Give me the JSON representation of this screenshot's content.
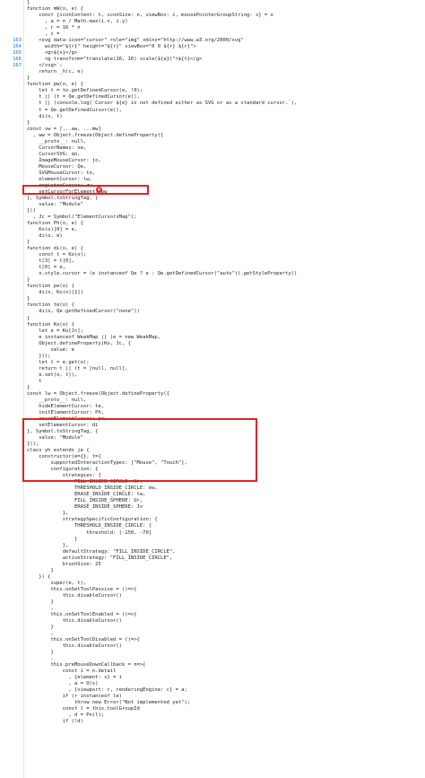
{
  "lines": [
    "}",
    "function mW(o, e) {",
    "    const {iconContent: t, iconSize: n, viewBox: i, mousePointerGroupString: s} = o",
    "      , a = n / Math.max(i.x, i.y)",
    "      , r = 16 * n",
    "      , c = `",
    "    <svg data-icon=\"cursor\" role=\"img\" xmlns=\"http://www.w3.org/2000/svg\"",
    "      width=\"${r}\" height=\"${r}\" viewBox=\"0 0 ${r} ${r}\">",
    "      <g>${s}</g>",
    "      <g transform=\"translate(16, 16) scale(${a})\">${t}</g>",
    "    </svg>`;",
    "    return _h(c, e)",
    "}",
    "function pw(o, e) {",
    "    let t = to.getDefinedCursor(e, !0);",
    "    t || (t = Qe.getDefinedCursor(e)),",
    "    t || (console.log(`Cursor ${e} is not defined either as SVG or as a standard cursor.`),",
    "    t = Qe.getDefinedCursor(e)),",
    "    di(o, t)",
    "}",
    "const vw = [...aw, ...mw]",
    "  , ww = Object.freeze(Object.defineProperty({",
    "    __proto__: null,",
    "    CursorNames: vw,",
    "    CursorSVG: qo,",
    "    ImageMouseCursor: jo,",
    "    MouseCursor: Qe,",
    "    SVGMouseCursor: to,",
    "    elementCursor: lw,",
    "    registerCursor: zw,",
    "    setCursorForElement: pw",
    "}, Symbol.toStringTag, {",
    "    value: \"Module\"",
    "}))",
    "  , Jc = Symbol(\"ElementCursorsMap\");",
    "function Ph(o, e) {",
    "    Ko(o)[0] = e,",
    "    di(o, e)",
    "}",
    "function di(o, e) {",
    "    const t = Ko(o);",
    "    t[3] = t[0],",
    "    t[0] = e,",
    "    o.style.cursor = (e instanceof Qe ? e : Qe.getDefinedCursor(\"auto\")).getStyleProperty()",
    "}",
    "function pe(o) {",
    "    di(o, Ko(o)[1])",
    "}",
    "function te(o) {",
    "    di(o, Qe.getDefinedCursor(\"none\"))",
    "}",
    "function Ko(o) {",
    "    let e = Ko[Jc];",
    "    e instanceof WeakMap || (e = new WeakMap,",
    "    Object.defineProperty(Ko, Jc, {",
    "        value: e",
    "    }));",
    "    let t = e.get(o);",
    "    return t || (t = [null, null],",
    "    e.set(o, t)),",
    "    t",
    "}",
    "const lw = Object.freeze(Object.defineProperty({",
    "    __proto__: null,",
    "    hideElementCursor: te,",
    "    initElementCursor: Ph,",
    "    resetElementCursor: pe,",
    "    setElementCursor: di",
    "}, Symbol.toStringTag, {",
    "    value: \"Module\"",
    "}));",
    "class yh extends je {",
    "    constructor(e={}, t={",
    "        supportedInteractionTypes: [\"Mouse\", \"Touch\"],",
    "        configuration: {",
    "            strategies: {",
    "                FILL_INSIDE_CIRCLE: Nr,",
    "                THRESHOLD_INSIDE_CIRCLE: ew,",
    "                ERASE_INSIDE_CIRCLE: tw,",
    "                FILL_INSIDE_SPHERE: Ur,",
    "                ERASE_INSIDE_SPHERE: Jv",
    "            },",
    "            strategySpecificConfiguration: {",
    "                THRESHOLD_INSIDE_CIRCLE: {",
    "                    threshold: [-150, -70]",
    "                }",
    "            },",
    "            defaultStrategy: \"FILL_INSIDE_CIRCLE\",",
    "            activeStrategy: \"FILL_INSIDE_CIRCLE\",",
    "            brushSize: 25",
    "        }",
    "    }) {",
    "        super(e, t),",
    "        this.onSetToolPassive = ()=>{",
    "            this.disableCursor()",
    "        }",
    "        ,",
    "        this.onSetToolEnabled = ()=>{",
    "            this.disableCursor()",
    "        }",
    "        ,",
    "        this.onSetToolDisabled = ()=>{",
    "            this.disableCursor()",
    "        }",
    "        ,",
    "        this.preMouseDownCallback = n=>{",
    "            const i = n.detail",
    "              , {element: s} = i",
    "              , a = O(s)",
    "              , {viewport: r, renderingEngine: c} = a;",
    "            if (r instanceof le)",
    "                throw new Error(\"Not implemented yet\");",
    "            const l = this.toolGroupId",
    "              , d = Pn(l);",
    "            if (!d)"
  ],
  "line_numbers": [
    {
      "row": 6,
      "label": "163"
    },
    {
      "row": 7,
      "label": "164"
    },
    {
      "row": 8,
      "label": "165"
    },
    {
      "row": 9,
      "label": "166"
    },
    {
      "row": 10,
      "label": "167"
    }
  ],
  "badge": {
    "glyph": "×"
  },
  "colors": {
    "highlight_border": "#e02424",
    "line_number": "#1a73e8",
    "keyword": "#1f1f1f"
  }
}
